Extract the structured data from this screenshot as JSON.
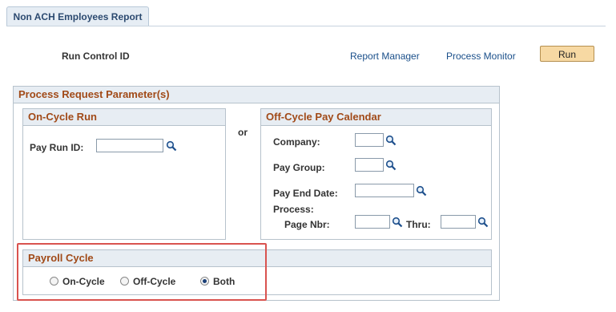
{
  "tab": {
    "label": "Non ACH Employees Report"
  },
  "header": {
    "run_control_label": "Run Control ID",
    "report_manager": "Report Manager",
    "process_monitor": "Process Monitor",
    "run_button": "Run"
  },
  "params": {
    "title": "Process Request Parameter(s)",
    "or_label": "or",
    "on_cycle": {
      "title": "On-Cycle Run",
      "pay_run_id_label": "Pay Run ID:",
      "pay_run_id_value": ""
    },
    "off_cycle": {
      "title": "Off-Cycle Pay Calendar",
      "company_label": "Company:",
      "pay_group_label": "Pay Group:",
      "pay_end_date_label": "Pay End Date:",
      "process_label": "Process:",
      "page_nbr_label": "Page Nbr:",
      "thru_label": "Thru:"
    },
    "payroll_cycle": {
      "title": "Payroll Cycle",
      "options": [
        "On-Cycle",
        "Off-Cycle",
        "Both"
      ],
      "selected": "Both"
    }
  },
  "icons": {
    "lookup": "magnifier-icon"
  },
  "colors": {
    "section_title": "#a14a18",
    "link": "#1a4f8a",
    "highlight": "#d9534f",
    "run_button": "#f7d9a3"
  }
}
